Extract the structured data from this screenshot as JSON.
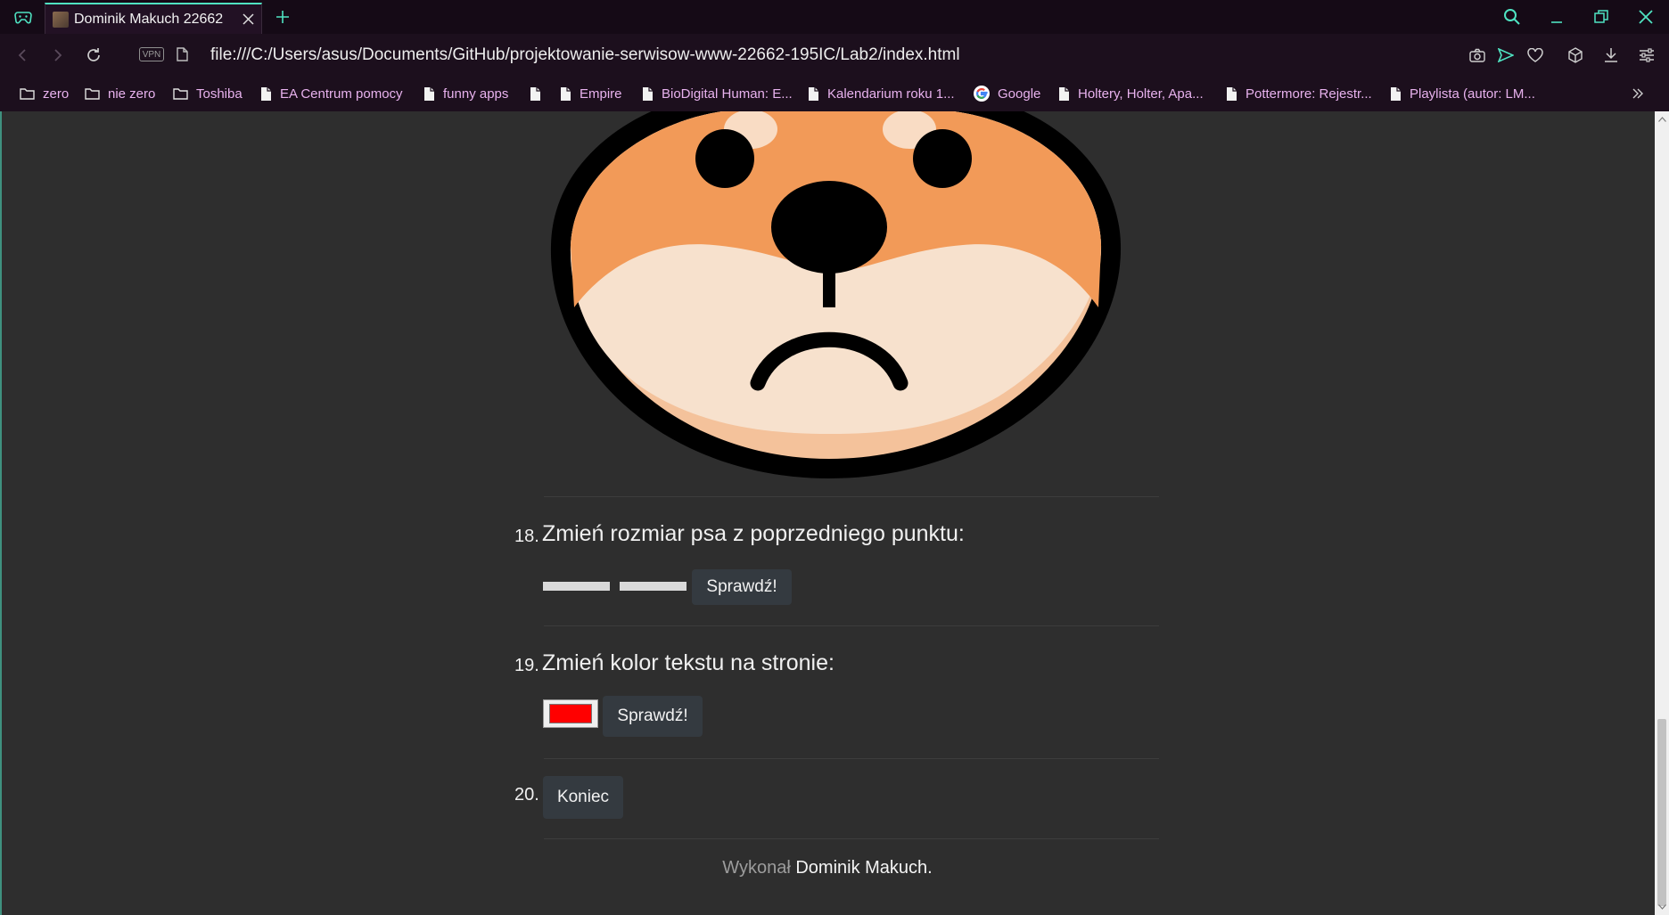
{
  "browser": {
    "tab_title": "Dominik Makuch 22662",
    "vpn_label": "VPN",
    "url": "file:///C:/Users/asus/Documents/GitHub/projektowanie-serwisow-www-22662-195IC/Lab2/index.html",
    "accent_color": "#4fe3c2",
    "bookmark_color": "#e8b2ee",
    "bookmarks": [
      {
        "label": "zero",
        "icon": "folder-icon"
      },
      {
        "label": "nie zero",
        "icon": "folder-icon"
      },
      {
        "label": "Toshiba",
        "icon": "folder-icon"
      },
      {
        "label": "EA Centrum pomocy",
        "icon": "page-icon"
      },
      {
        "label": "funny apps",
        "icon": "page-icon"
      },
      {
        "label": "",
        "icon": "page-icon"
      },
      {
        "label": "Empire",
        "icon": "page-icon"
      },
      {
        "label": "BioDigital Human: E...",
        "icon": "page-icon"
      },
      {
        "label": "Kalendarium roku 1...",
        "icon": "page-icon"
      },
      {
        "label": "Google",
        "icon": "google-icon"
      },
      {
        "label": "Holtery, Holter, Apa...",
        "icon": "page-icon"
      },
      {
        "label": "Pottermore: Rejestr...",
        "icon": "page-icon"
      },
      {
        "label": "Playlista (autor: LM...",
        "icon": "page-icon"
      }
    ]
  },
  "page": {
    "background": "#2e2e2e",
    "q18": {
      "number": "18.",
      "text": "Zmień rozmiar psa z poprzedniego punktu:",
      "button": "Sprawdź!"
    },
    "q19": {
      "number": "19.",
      "text": "Zmień kolor tekstu na stronie:",
      "color_value": "#ff0000",
      "button": "Sprawdź!"
    },
    "q20": {
      "number": "20.",
      "button": "Koniec"
    },
    "footer": {
      "prefix": "Wykonał",
      "name": "Dominik Makuch",
      "suffix": "."
    }
  }
}
